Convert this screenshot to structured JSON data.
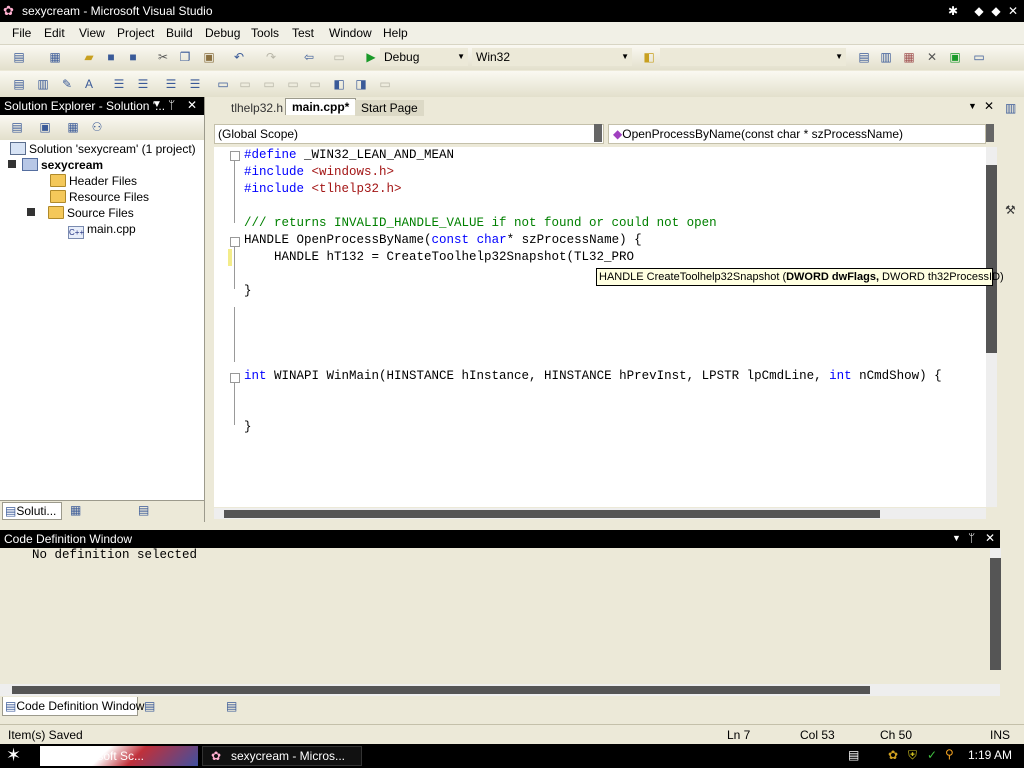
{
  "window": {
    "title": "sexycream - Microsoft Visual Studio"
  },
  "menu": [
    "File",
    "Edit",
    "View",
    "Project",
    "Build",
    "Debug",
    "Tools",
    "Test",
    "Window",
    "Help"
  ],
  "toolbar": {
    "config": "Debug",
    "platform": "Win32"
  },
  "solution_explorer": {
    "title": "Solution Explorer - Solution '...",
    "items": [
      {
        "label": "Solution 'sexycream' (1 project)"
      },
      {
        "label": "sexycream"
      },
      {
        "label": "Header Files"
      },
      {
        "label": "Resource Files"
      },
      {
        "label": "Source Files"
      },
      {
        "label": "main.cpp"
      }
    ],
    "bottom_tab": "Soluti..."
  },
  "doc_tabs": [
    "tlhelp32.h",
    "main.cpp*",
    "Start Page"
  ],
  "nav": {
    "scope": "(Global Scope)",
    "member": "OpenProcessByName(const char * szProcessName)"
  },
  "code": {
    "line1_directive": "#define",
    "line1_rest": " _WIN32_LEAN_AND_MEAN",
    "line2_directive": "#include",
    "line2_rest": " <windows.h>",
    "line3_directive": "#include",
    "line3_rest": " <tlhelp32.h>",
    "line5": "/// returns INVALID_HANDLE_VALUE if not found or could not open",
    "line6_a": "HANDLE OpenProcessByName(",
    "line6_kw1": "const",
    "line6_b": " ",
    "line6_kw2": "char",
    "line6_c": "* szProcessName) {",
    "line7": "    HANDLE hT132 = CreateToolhelp32Snapshot(TL32_PRO",
    "line8": "}",
    "line14_kw": "int",
    "line14_a": " WINAPI WinMain(HINSTANCE hInstance, HINSTANCE hPrevInst, LPSTR lpCmdLine, ",
    "line14_kw2": "int",
    "line14_b": " nCmdShow) {",
    "line17": "}"
  },
  "tooltip": {
    "pre": "HANDLE CreateToolhelp32Snapshot (",
    "bold": "DWORD dwFlags,",
    "post": " DWORD th32ProcessID)"
  },
  "code_definition": {
    "title": "Code Definition Window",
    "text": "No definition selected",
    "tab": "Code Definition Window"
  },
  "status": {
    "message": "Item(s) Saved",
    "ln": "Ln 7",
    "col": "Col 53",
    "ch": "Ch 50",
    "mode": "INS"
  },
  "taskbar": {
    "task1": "Microsoft Sc...",
    "task2": "sexycream - Micros...",
    "clock": "1:19 AM"
  }
}
